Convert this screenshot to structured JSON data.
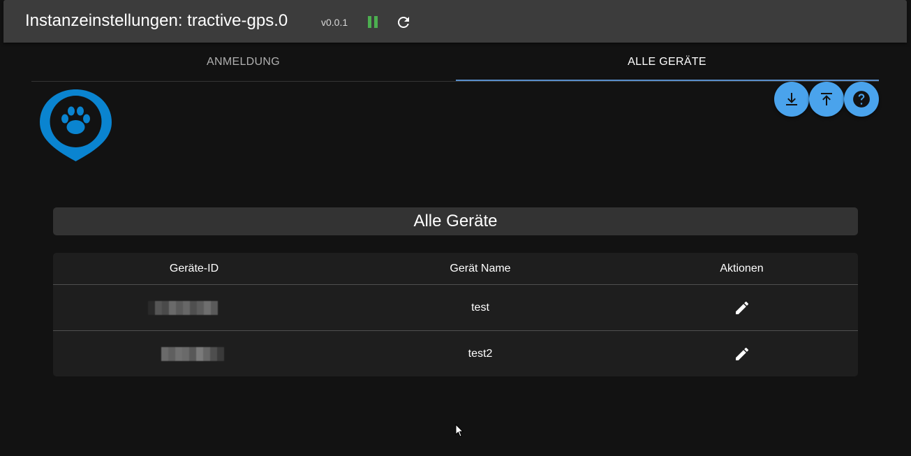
{
  "header": {
    "title": "Instanzeinstellungen: tractive-gps.0",
    "version": "v0.0.1",
    "pause_icon": "pause-icon",
    "reload_icon": "reload-icon",
    "pause_color": "#4caf50"
  },
  "tabs": [
    {
      "label": "ANMELDUNG",
      "active": false
    },
    {
      "label": "ALLE GERÄTE",
      "active": true
    }
  ],
  "logo": {
    "icon": "tractive-paw-pin-logo",
    "color": "#0a84d0"
  },
  "actions": [
    {
      "icon": "download-icon"
    },
    {
      "icon": "upload-icon"
    },
    {
      "icon": "help-icon"
    }
  ],
  "section": {
    "title": "Alle Geräte"
  },
  "table": {
    "columns": [
      "Geräte-ID",
      "Gerät Name",
      "Aktionen"
    ],
    "rows": [
      {
        "name": "test",
        "action_icon": "edit-icon"
      },
      {
        "name": "test2",
        "action_icon": "edit-icon"
      }
    ]
  },
  "colors": {
    "background": "#121212",
    "header": "#3c3c3c",
    "accent": "#4aa3ec",
    "tab_indicator": "#5a8fcc",
    "panel": "#1e1e1e",
    "section_bar": "#333333"
  }
}
